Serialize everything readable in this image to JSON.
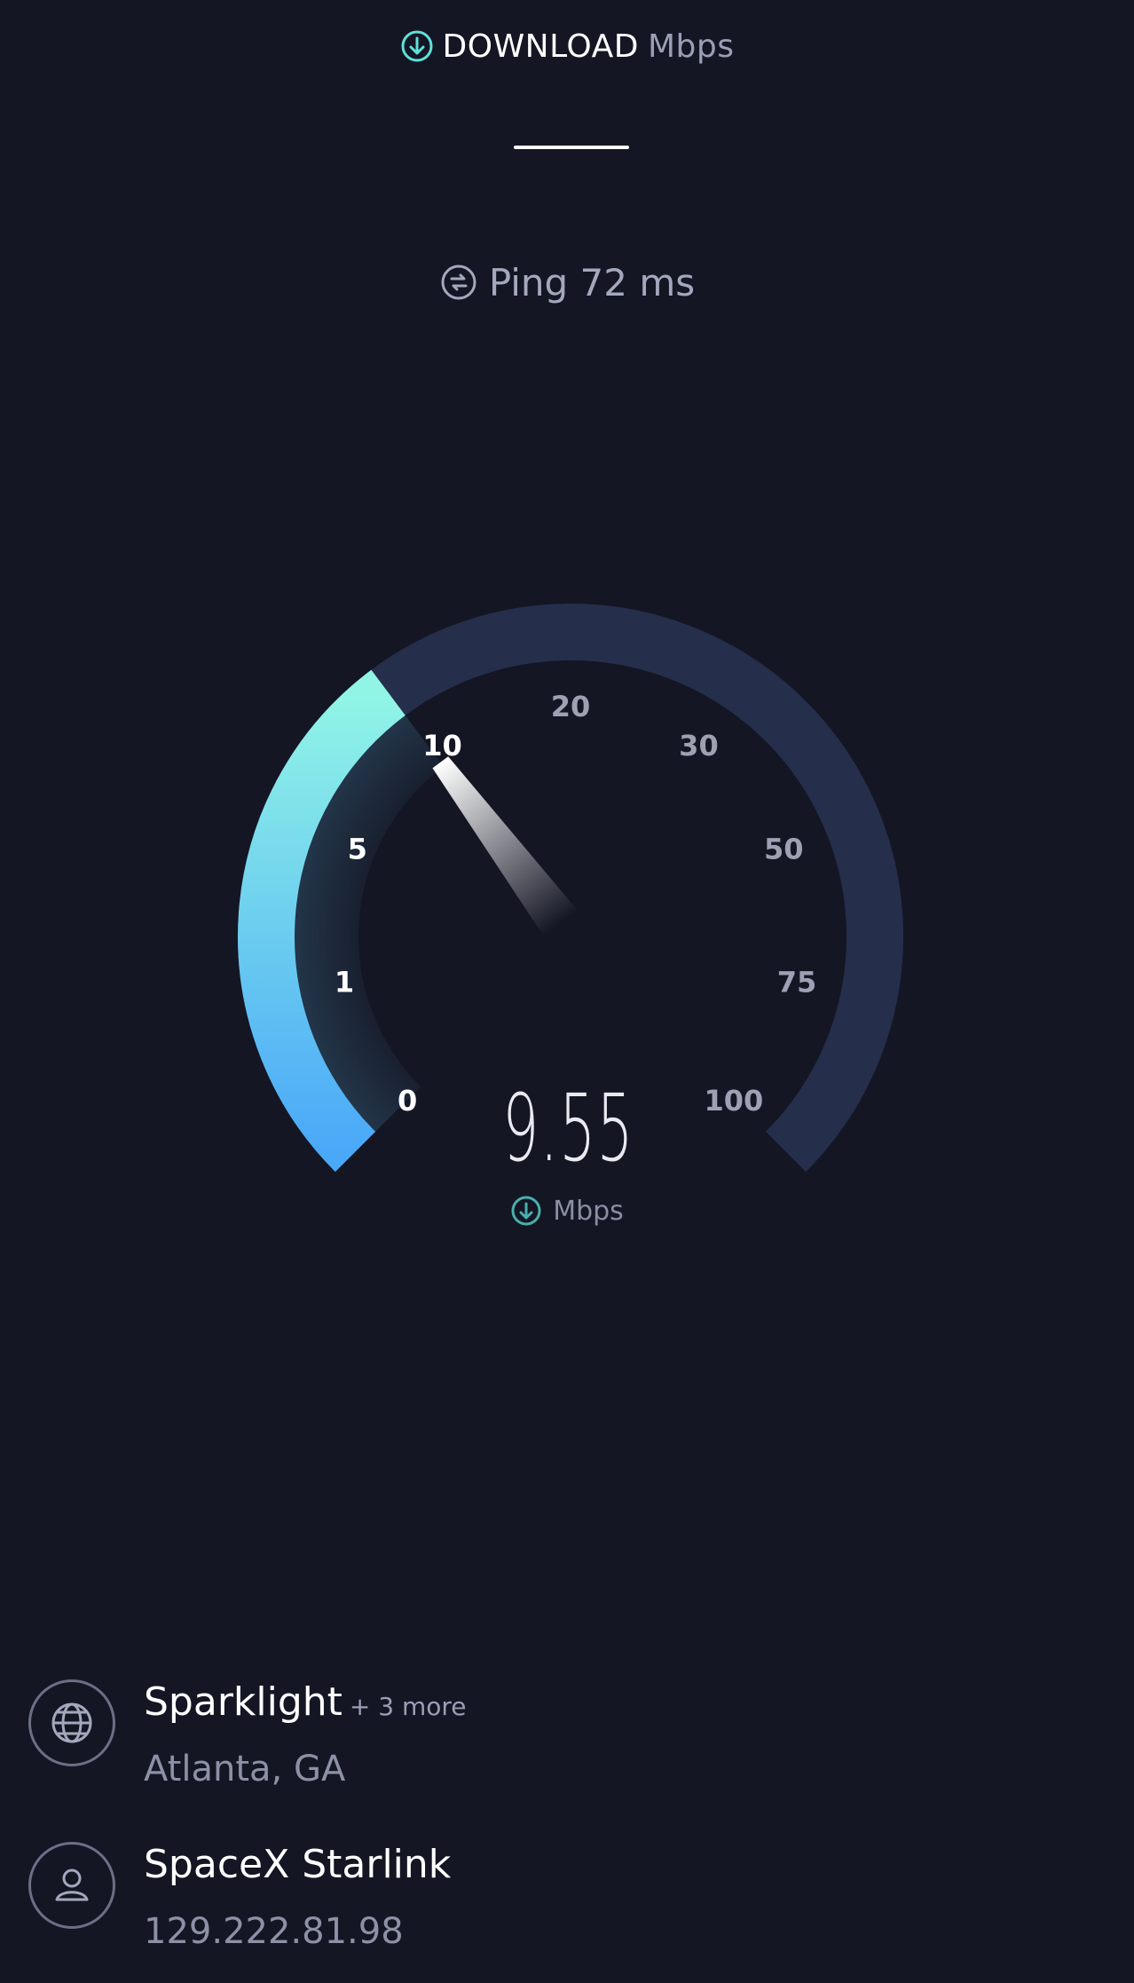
{
  "header": {
    "title": "DOWNLOAD",
    "unit": "Mbps",
    "icon": "download-arrow-icon"
  },
  "ping": {
    "label": "Ping 72 ms",
    "icon": "ping-icon"
  },
  "gauge": {
    "value": 9.55,
    "max": 100,
    "tick_labels": [
      "0",
      "1",
      "5",
      "10",
      "20",
      "30",
      "50",
      "75",
      "100"
    ],
    "active_ticks": 3,
    "colors": {
      "track": "#252e4a",
      "progress_start": "#4aa8f8",
      "progress_end": "#91f5e6",
      "tick_active": "#ffffff",
      "tick_inactive": "#9ea1b3"
    }
  },
  "readout": {
    "value": "9.55",
    "unit": "Mbps"
  },
  "server": {
    "name": "Sparklight",
    "more": "+ 3 more",
    "location": "Atlanta, GA",
    "icon": "globe-icon"
  },
  "isp": {
    "name": "SpaceX Starlink",
    "ip": "129.222.81.98",
    "icon": "user-icon"
  },
  "colors": {
    "background": "#141624",
    "accent": "#5ee1d8"
  }
}
